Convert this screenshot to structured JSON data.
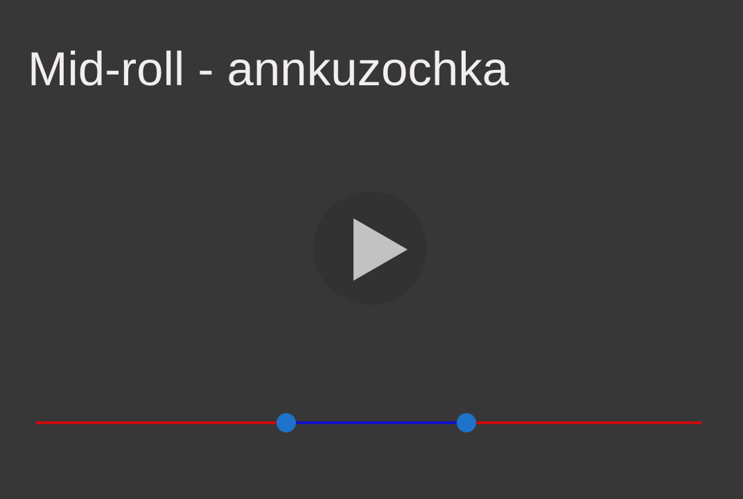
{
  "title": "Mid-roll - annkuzochka",
  "play_icon": "play-icon",
  "range": {
    "start": 0.376,
    "end": 0.647
  },
  "colors": {
    "background": "#373737",
    "title": "#f3eeee",
    "play_circle": "#323232",
    "play_triangle": "#c2c2c2",
    "track_outside": "#cc0a0a",
    "track_selected": "#1010c8",
    "thumb": "#1f72c9"
  }
}
